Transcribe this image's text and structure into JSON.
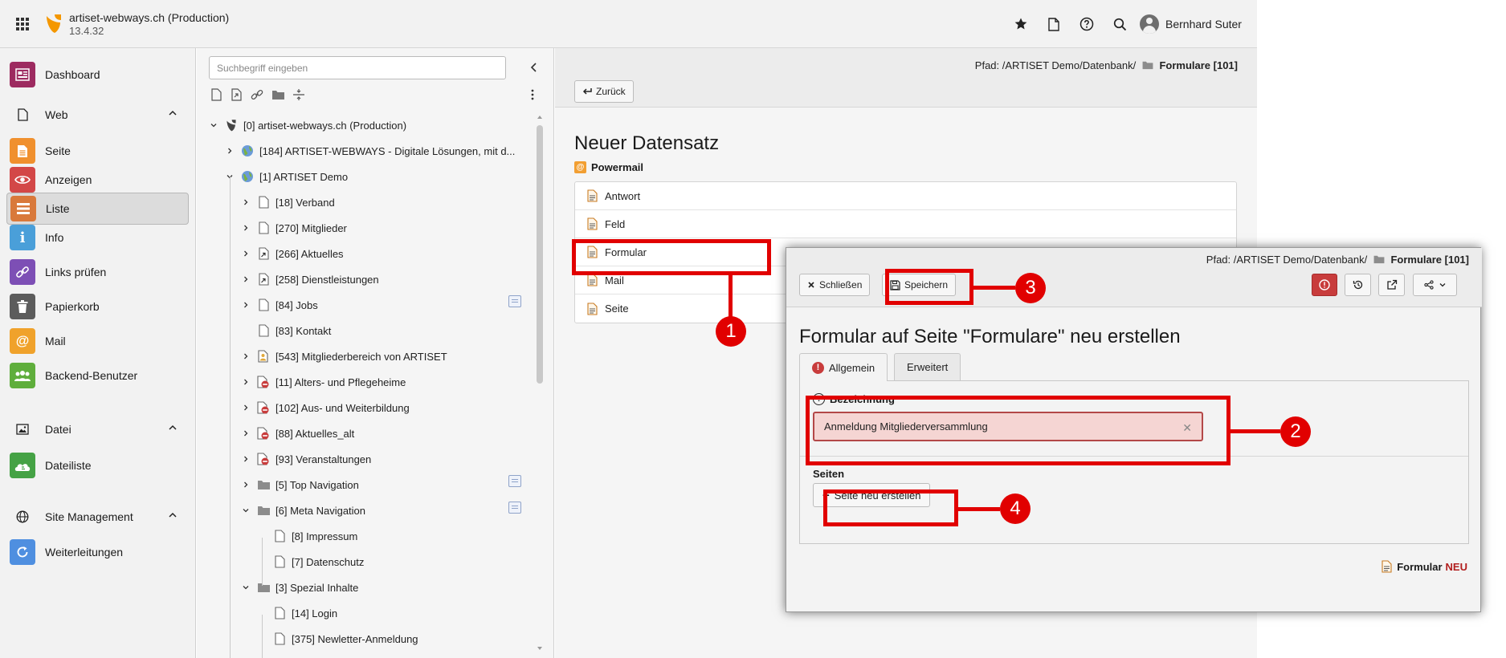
{
  "topbar": {
    "site_name": "artiset-webways.ch (Production)",
    "site_version": "13.4.32",
    "user_name": "Bernhard Suter",
    "icons": [
      "apps-grid-icon",
      "typo3-logo",
      "star-icon",
      "file-icon",
      "help-icon",
      "search-icon",
      "user-avatar"
    ]
  },
  "module_menu": {
    "dashboard": "Dashboard",
    "groups": {
      "web": "Web",
      "datei": "Datei",
      "site_management": "Site Management"
    },
    "items": {
      "seite": "Seite",
      "anzeigen": "Anzeigen",
      "liste": "Liste",
      "info": "Info",
      "links_pruefen": "Links prüfen",
      "papierkorb": "Papierkorb",
      "mail": "Mail",
      "backend_benutzer": "Backend-Benutzer",
      "dateiliste": "Dateiliste",
      "weiterleitungen": "Weiterleitungen"
    },
    "colors": {
      "dashboard": "#9d2b60",
      "seite": "#f0902e",
      "anzeigen": "#d34747",
      "liste": "#d9793b",
      "info": "#4a9fd9",
      "links_pruefen": "#7d4fb5",
      "papierkorb": "#5c5c5c",
      "mail": "#f0a22b",
      "backend_benutzer": "#5fae3c",
      "dateiliste": "#45a245",
      "weiterleitungen": "#4f8fe0"
    }
  },
  "tree": {
    "search_placeholder": "Suchbegriff eingeben",
    "rows": [
      "[0] artiset-webways.ch (Production)",
      "[184] ARTISET-WEBWAYS - Digitale Lösungen, mit d...",
      "[1] ARTISET Demo",
      "[18] Verband",
      "[270] Mitglieder",
      "[266] Aktuelles",
      "[258] Dienstleistungen",
      "[84] Jobs",
      "[83] Kontakt",
      "[543] Mitgliederbereich von ARTISET",
      "[11] Alters- und Pflegeheime",
      "[102] Aus- und Weiterbildung",
      "[88] Aktuelles_alt",
      "[93] Veranstaltungen",
      "[5] Top Navigation",
      "[6] Meta Navigation",
      "[8] Impressum",
      "[7] Datenschutz",
      "[3] Spezial Inhalte",
      "[14] Login",
      "[375] Newletter-Anmeldung"
    ]
  },
  "content": {
    "path_prefix": "Pfad: /ARTISET Demo/Datenbank/",
    "path_current": "Formulare [101]",
    "back_button": "Zurück",
    "title": "Neuer Datensatz",
    "extension": "Powermail",
    "records": [
      "Antwort",
      "Feld",
      "Formular",
      "Mail",
      "Seite"
    ]
  },
  "dialog": {
    "path_prefix": "Pfad: /ARTISET Demo/Datenbank/",
    "path_current": "Formulare [101]",
    "close_button": "Schließen",
    "save_button": "Speichern",
    "title": "Formular auf Seite \"Formulare\" neu erstellen",
    "tabs": [
      "Allgemein",
      "Erweitert"
    ],
    "field_label": "Bezeichnung",
    "field_value": "Anmeldung Mitgliederversammlung",
    "pages_label": "Seiten",
    "new_page_button": "Seite neu erstellen",
    "footer_type": "Formular",
    "footer_state": "NEU"
  },
  "callouts": [
    "1",
    "2",
    "3",
    "4"
  ]
}
